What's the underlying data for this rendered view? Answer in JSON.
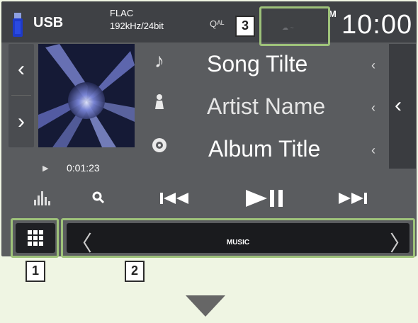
{
  "status_bar": {
    "source_label": "USB",
    "format_line1": "FLAC",
    "format_line2": "192kHz/24bit",
    "audio_indicator": "Qᴬᴸ",
    "ampm": "M",
    "clock": "10:00"
  },
  "track": {
    "title": "Song Tilte",
    "artist": "Artist Name",
    "album": "Album Title",
    "elapsed": "0:01:23"
  },
  "icons": {
    "title": "music-note-icon",
    "artist": "artist-icon",
    "album": "disc-icon",
    "equalizer": "equalizer-icon",
    "search": "search-icon",
    "prev": "previous-track-icon",
    "playpause": "play-pause-icon",
    "next": "next-track-icon",
    "apps": "apps-grid-icon"
  },
  "dock": {
    "label": "MUSIC"
  },
  "callouts": {
    "c1": "1",
    "c2": "2",
    "c3": "3"
  },
  "colors": {
    "callout_frame": "#9ec27a",
    "screen_bg": "#5a5c5f",
    "topbar_bg": "#3f4145",
    "page_bg": "#eff5e3"
  }
}
